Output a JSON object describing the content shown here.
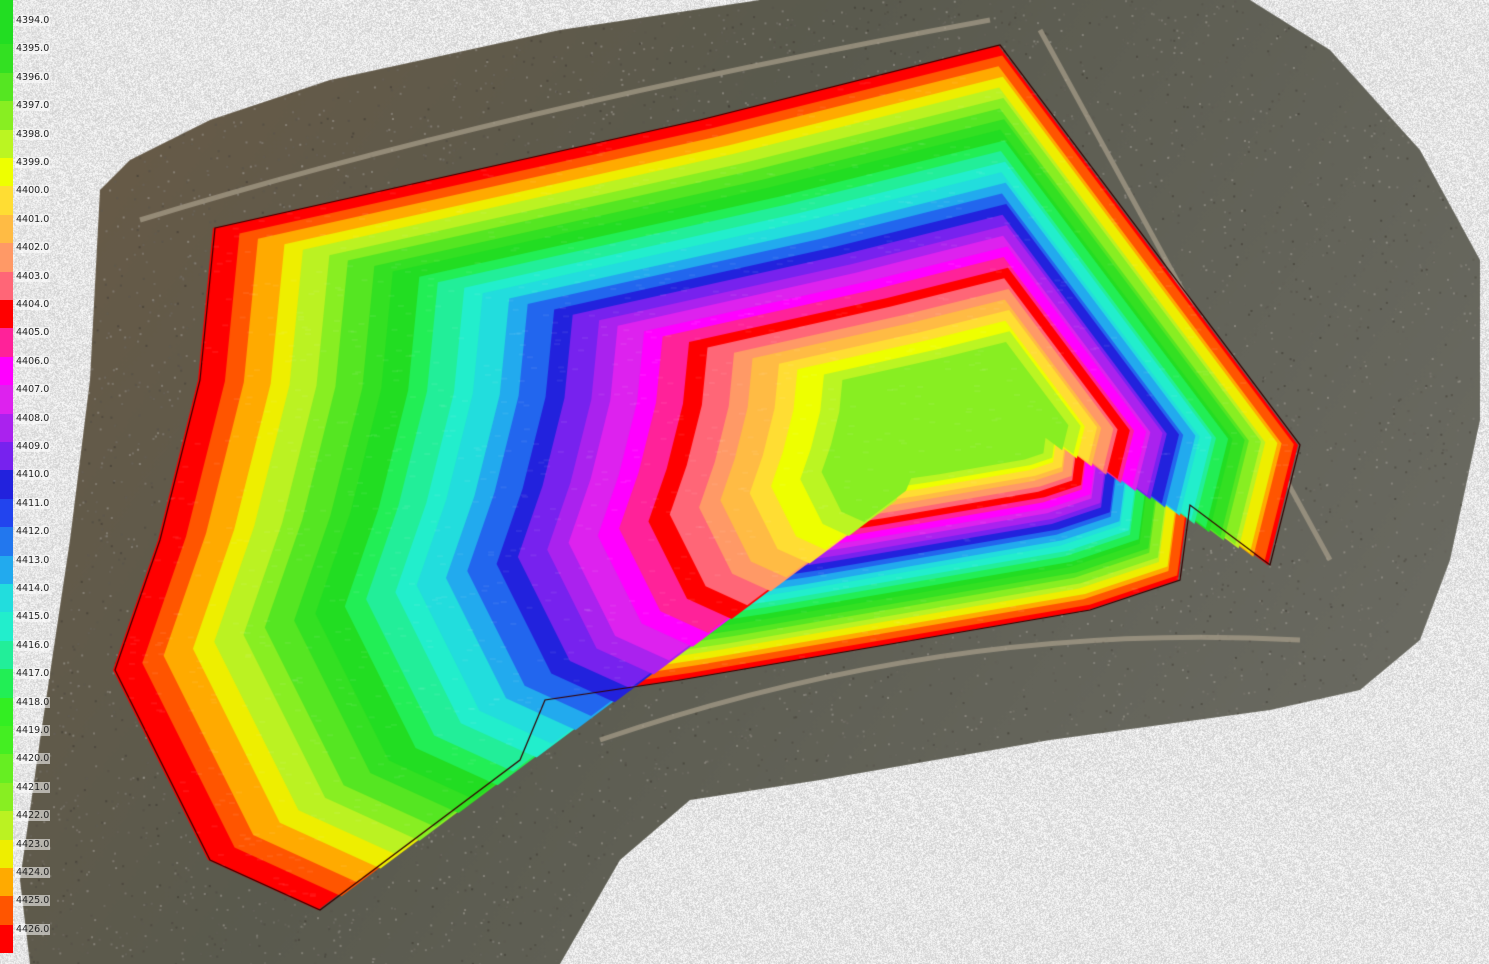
{
  "legend": {
    "entries": [
      {
        "label": "4394.0",
        "color": "#22dd22"
      },
      {
        "label": "4395.0",
        "color": "#33e022"
      },
      {
        "label": "4396.0",
        "color": "#55e622"
      },
      {
        "label": "4397.0",
        "color": "#88ee22"
      },
      {
        "label": "4398.0",
        "color": "#bbf522"
      },
      {
        "label": "4399.0",
        "color": "#eeff00"
      },
      {
        "label": "4400.0",
        "color": "#ffdd33"
      },
      {
        "label": "4401.0",
        "color": "#ffbb44"
      },
      {
        "label": "4402.0",
        "color": "#ff9966"
      },
      {
        "label": "4403.0",
        "color": "#ff6677"
      },
      {
        "label": "4404.0",
        "color": "#ff0000"
      },
      {
        "label": "4405.0",
        "color": "#ff2299"
      },
      {
        "label": "4406.0",
        "color": "#ff00ff"
      },
      {
        "label": "4407.0",
        "color": "#dd22ee"
      },
      {
        "label": "4408.0",
        "color": "#aa22ee"
      },
      {
        "label": "4409.0",
        "color": "#7722ee"
      },
      {
        "label": "4410.0",
        "color": "#2222dd"
      },
      {
        "label": "4411.0",
        "color": "#2244ee"
      },
      {
        "label": "4412.0",
        "color": "#2277ee"
      },
      {
        "label": "4413.0",
        "color": "#22aaee"
      },
      {
        "label": "4414.0",
        "color": "#22dddd"
      },
      {
        "label": "4415.0",
        "color": "#22eecc"
      },
      {
        "label": "4416.0",
        "color": "#22ee99"
      },
      {
        "label": "4417.0",
        "color": "#22ee55"
      },
      {
        "label": "4418.0",
        "color": "#33ee22"
      },
      {
        "label": "4419.0",
        "color": "#44ee22"
      },
      {
        "label": "4420.0",
        "color": "#66ee22"
      },
      {
        "label": "4421.0",
        "color": "#88ee22"
      },
      {
        "label": "4422.0",
        "color": "#bbf222"
      },
      {
        "label": "4423.0",
        "color": "#eeee00"
      },
      {
        "label": "4424.0",
        "color": "#ffaa00"
      },
      {
        "label": "4425.0",
        "color": "#ff5500"
      },
      {
        "label": "4426.0",
        "color": "#ff0000"
      }
    ]
  },
  "map": {
    "terrain_color": "#5a5a4e",
    "nodata_color": "#e8e8e8"
  }
}
